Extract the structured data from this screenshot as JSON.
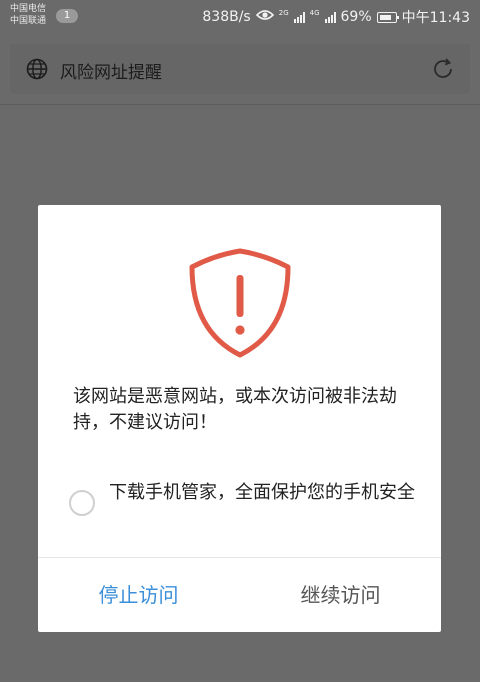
{
  "status_bar": {
    "carrier_1": "中国电信",
    "carrier_2": "中国联通",
    "notification_count": "1",
    "net_speed": "838B/s",
    "signal_1_type": "2G",
    "signal_2_type": "4G",
    "battery": "69%",
    "time": "中午11:43",
    "icons": [
      "eye-icon",
      "signal-icon",
      "battery-icon"
    ]
  },
  "url_bar": {
    "title": "风险网址提醒",
    "icons": [
      "globe-icon",
      "refresh-icon"
    ]
  },
  "dialog": {
    "warning_icon": "shield-exclamation-icon",
    "accent_color": "#e05a47",
    "message": "该网站是恶意网站，或本次访问被非法劫持，不建议访问！",
    "option_label": "下载手机管家，全面保护您的手机安全",
    "option_checked": false,
    "stop_button": "停止访问",
    "continue_button": "继续访问",
    "stop_color": "#3b8fd9"
  }
}
